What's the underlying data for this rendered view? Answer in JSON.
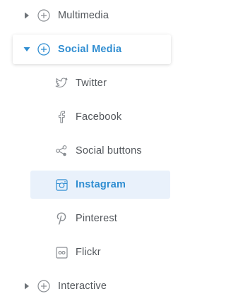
{
  "categories": {
    "multimedia": {
      "label": "Multimedia",
      "expanded": false
    },
    "social_media": {
      "label": "Social Media",
      "expanded": true
    },
    "interactive": {
      "label": "Interactive",
      "expanded": false
    }
  },
  "social_media_items": [
    {
      "label": "Twitter",
      "icon": "twitter-icon"
    },
    {
      "label": "Facebook",
      "icon": "facebook-icon"
    },
    {
      "label": "Social buttons",
      "icon": "share-icon"
    },
    {
      "label": "Instagram",
      "icon": "instagram-icon",
      "selected": true
    },
    {
      "label": "Pinterest",
      "icon": "pinterest-icon"
    },
    {
      "label": "Flickr",
      "icon": "flickr-icon"
    }
  ],
  "colors": {
    "accent": "#2f8dd1",
    "text": "#52565b",
    "icon": "#8a8e93",
    "selected_bg": "#e9f1fb"
  }
}
